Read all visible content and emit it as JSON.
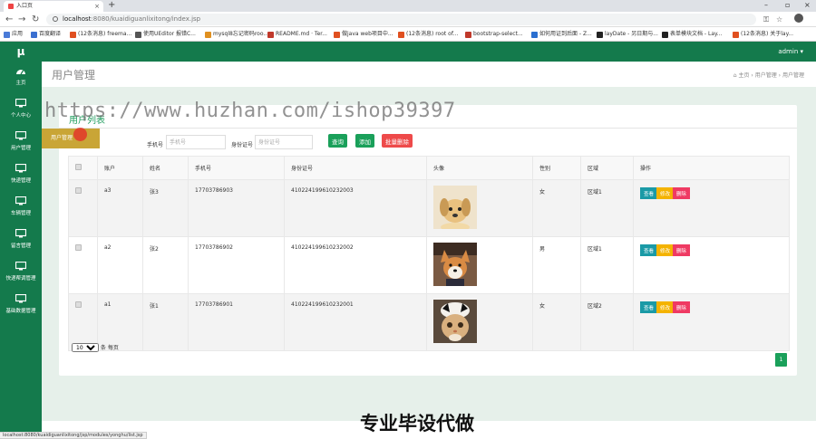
{
  "browser": {
    "tab_title": "入口页",
    "address": {
      "host": "localhost",
      "path": ":8080/kuaidiguanlixitong/index.jsp"
    },
    "bookmarks": [
      {
        "label": "应用",
        "color": "#4a7bd8"
      },
      {
        "label": "百度翻译",
        "color": "#3a6fd0"
      },
      {
        "label": "(12条消息) freema...",
        "color": "#e05020"
      },
      {
        "label": "使用UEditor 报错C...",
        "color": "#555555"
      },
      {
        "label": "mysql8忘记密码roo...",
        "color": "#e09020"
      },
      {
        "label": "README.md · Ter...",
        "color": "#c0392b"
      },
      {
        "label": "做java web项目中...",
        "color": "#e05020"
      },
      {
        "label": "(12条消息) root of...",
        "color": "#e05020"
      },
      {
        "label": "bootstrap-select...",
        "color": "#c0392b"
      },
      {
        "label": "如何用证到后面 - Z...",
        "color": "#2a6fd0"
      },
      {
        "label": "layDate - 另日期与...",
        "color": "#222222"
      },
      {
        "label": "表单模块文档 - Lay...",
        "color": "#222222"
      },
      {
        "label": "(12条消息) 关于lay...",
        "color": "#e05020"
      }
    ],
    "status_url": "localhost:8080/kuaidiguanlixitong/jsp/modules/yonghu/list.jsp"
  },
  "app": {
    "logo": "μ",
    "user_menu": "admin ▾",
    "sidebar": [
      {
        "label": "主页",
        "icon": "dashboard-icon"
      },
      {
        "label": "个人中心",
        "icon": "monitor-icon"
      },
      {
        "label": "用户管理",
        "icon": "monitor-icon"
      },
      {
        "label": "快递管理",
        "icon": "monitor-icon"
      },
      {
        "label": "车辆管理",
        "icon": "monitor-icon"
      },
      {
        "label": "留言管理",
        "icon": "monitor-icon"
      },
      {
        "label": "快递帮调管理",
        "icon": "monitor-icon"
      },
      {
        "label": "基础数据管理",
        "icon": "monitor-icon"
      }
    ],
    "page_title": "用户管理",
    "breadcrumb": [
      "主页",
      "用户管理",
      "用户管理"
    ],
    "card_title": "用户列表",
    "search": {
      "phone_label": "手机号",
      "phone_placeholder": "手机号",
      "id_label": "身份证号",
      "id_placeholder": "身份证号",
      "query_button": "查询",
      "add_button": "添加",
      "batch_delete_button": "批量删除"
    },
    "table": {
      "headers": [
        "账户",
        "姓名",
        "手机号",
        "身份证号",
        "头像",
        "性别",
        "区域",
        "操作"
      ],
      "rows": [
        {
          "account": "a3",
          "name": "张3",
          "phone": "17703786903",
          "id_number": "410224199610232003",
          "avatar": "puppy-photo",
          "gender": "女",
          "area": "区域1"
        },
        {
          "account": "a2",
          "name": "张2",
          "phone": "17703786902",
          "id_number": "410224199610232002",
          "avatar": "shiba-photo",
          "gender": "男",
          "area": "区域1"
        },
        {
          "account": "a1",
          "name": "张1",
          "phone": "17703786901",
          "id_number": "410224199610232001",
          "avatar": "cat-photo",
          "gender": "女",
          "area": "区域2"
        }
      ],
      "actions": {
        "view": "查看",
        "edit": "修改",
        "delete": "删除"
      }
    },
    "pager": {
      "page_size": "10",
      "page_size_suffix": "条 每页",
      "current_page": "1"
    },
    "tooltip": "用户管理"
  },
  "watermarks": {
    "url": "https://www.huzhan.com/ishop39397",
    "caption": "专业毕设代做"
  },
  "colors": {
    "brand_green": "#147a4c",
    "button_green": "#1aa05a",
    "danger": "#ee4a4a",
    "warning": "#f4b300"
  }
}
